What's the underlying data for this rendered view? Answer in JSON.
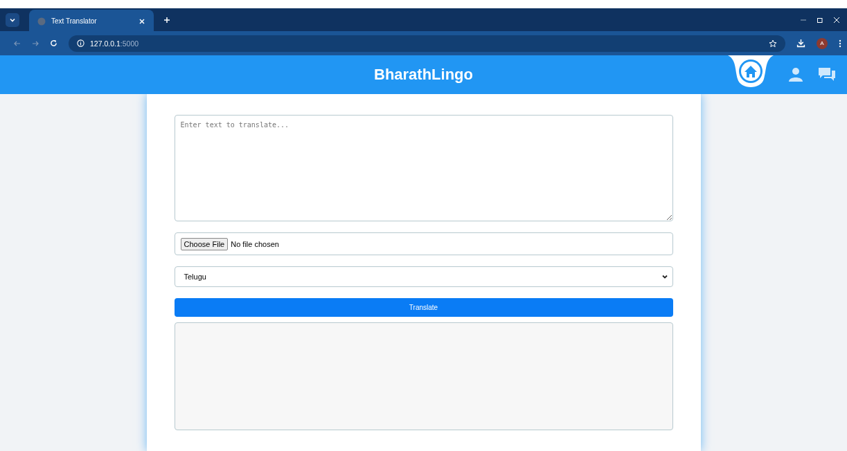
{
  "browser": {
    "tab_title": "Text Translator",
    "url_host": "127.0.0.1",
    "url_port": ":5000",
    "profile_initial": "A"
  },
  "header": {
    "title": "BharathLingo"
  },
  "form": {
    "text_placeholder": "Enter text to translate...",
    "file_button": "Choose File",
    "file_status": "No file chosen",
    "language": "Telugu",
    "submit": "Translate"
  }
}
